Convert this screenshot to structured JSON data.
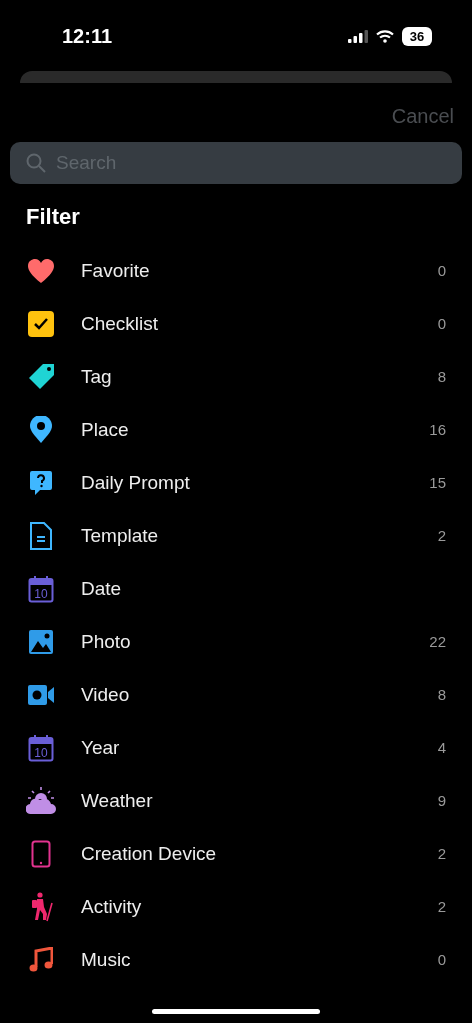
{
  "status_bar": {
    "time": "12:11",
    "battery": "36"
  },
  "cancel": "Cancel",
  "search": {
    "placeholder": "Search"
  },
  "filter": {
    "title": "Filter",
    "items": [
      {
        "kind": "heart",
        "label": "Favorite",
        "count": "0"
      },
      {
        "kind": "checklist",
        "label": "Checklist",
        "count": "0"
      },
      {
        "kind": "tag",
        "label": "Tag",
        "count": "8"
      },
      {
        "kind": "pin",
        "label": "Place",
        "count": "16"
      },
      {
        "kind": "prompt",
        "label": "Daily Prompt",
        "count": "15"
      },
      {
        "kind": "document",
        "label": "Template",
        "count": "2"
      },
      {
        "kind": "calendar",
        "icon_text": "10",
        "label": "Date"
      },
      {
        "kind": "photo",
        "label": "Photo",
        "count": "22"
      },
      {
        "kind": "video",
        "label": "Video",
        "count": "8"
      },
      {
        "kind": "calendar",
        "icon_text": "10",
        "label": "Year",
        "count": "4"
      },
      {
        "kind": "weather",
        "label": "Weather",
        "count": "9"
      },
      {
        "kind": "tablet",
        "label": "Creation Device",
        "count": "2"
      },
      {
        "kind": "hiker",
        "label": "Activity",
        "count": "2"
      },
      {
        "kind": "music",
        "label": "Music",
        "count": "0"
      }
    ]
  }
}
